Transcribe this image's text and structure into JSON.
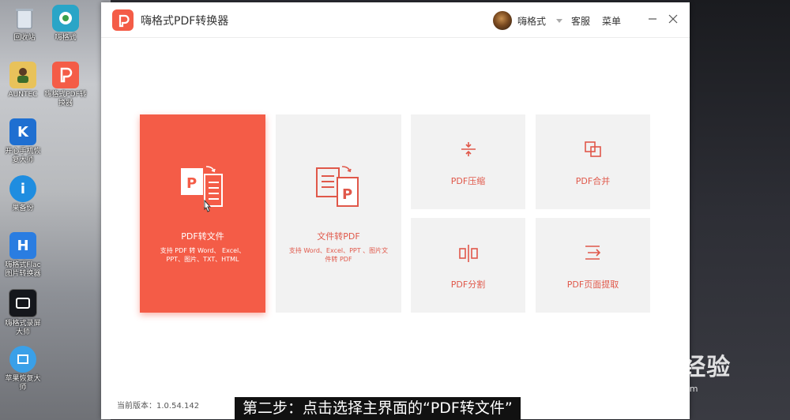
{
  "desktop": {
    "icons": [
      {
        "label": "回收站",
        "icon": "recycle-bin-icon"
      },
      {
        "label": "嗨格式",
        "icon": "app-icon"
      },
      {
        "label": "AUNTEC",
        "icon": "user-folder-icon"
      },
      {
        "label": "嗨格式PDF转\n换器",
        "icon": "pdf-converter-icon"
      },
      {
        "label": "开心手机恢\n复大师",
        "icon": "phone-recovery-icon"
      },
      {
        "label": "果备份",
        "icon": "backup-icon"
      },
      {
        "label": "嗨格式Flac\n图片转换器",
        "icon": "image-converter-icon"
      },
      {
        "label": "嗨格式录屏\n大师",
        "icon": "screen-recorder-icon"
      },
      {
        "label": "苹果恢复大\n师",
        "icon": "apple-recovery-icon"
      }
    ]
  },
  "app": {
    "title": "嗨格式PDF转换器",
    "user_name": "嗨格式",
    "service_label": "客服",
    "menu_label": "菜单",
    "version": "当前版本：1.0.54.142"
  },
  "tiles": {
    "pdf_to_file": {
      "title": "PDF转文件",
      "desc": "支持 PDF 转 Word、 Excel、\nPPT、图片、TXT、HTML"
    },
    "file_to_pdf": {
      "title": "文件转PDF",
      "desc": "支持 Word、Excel、PPT 、图片文\n件转 PDF"
    },
    "compress": {
      "title": "PDF压缩"
    },
    "merge": {
      "title": "PDF合并"
    },
    "split": {
      "title": "PDF分割"
    },
    "extract": {
      "title": "PDF页面提取"
    }
  },
  "caption": "第二步：点击选择主界面的“PDF转文件”",
  "watermark": {
    "brand": "Baidu经验",
    "url": "jingyan.baidu.com"
  },
  "colors": {
    "accent": "#f45c47",
    "tile_bg": "#f2f2f2"
  }
}
